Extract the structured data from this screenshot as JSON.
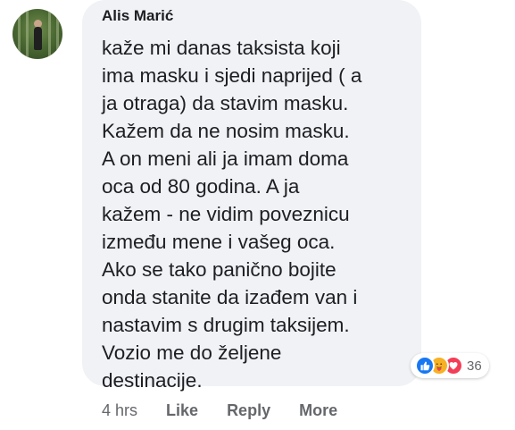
{
  "comment": {
    "author": "Alis Marić",
    "lines": [
      "kaže mi danas taksista koji",
      "ima masku i sjedi naprijed ( a",
      "ja otraga) da stavim masku.",
      "Kažem da ne nosim masku.",
      "A on meni ali ja imam doma",
      "oca od 80 godina. A ja",
      "kažem - ne vidim poveznicu",
      "između mene i vašeg oca.",
      "Ako se tako panično bojite",
      "onda stanite da izađem van i",
      "nastavim s drugim taksijem.",
      "Vozio me do željene",
      "destinacije."
    ]
  },
  "reactions": {
    "icons": [
      "like-icon",
      "care-icon",
      "love-icon"
    ],
    "count": "36",
    "colors": {
      "like": "#1877f2",
      "care": "#f7b125",
      "love": "#f33e58"
    }
  },
  "meta": {
    "time": "4 hrs",
    "like_label": "Like",
    "reply_label": "Reply",
    "more_label": "More"
  }
}
